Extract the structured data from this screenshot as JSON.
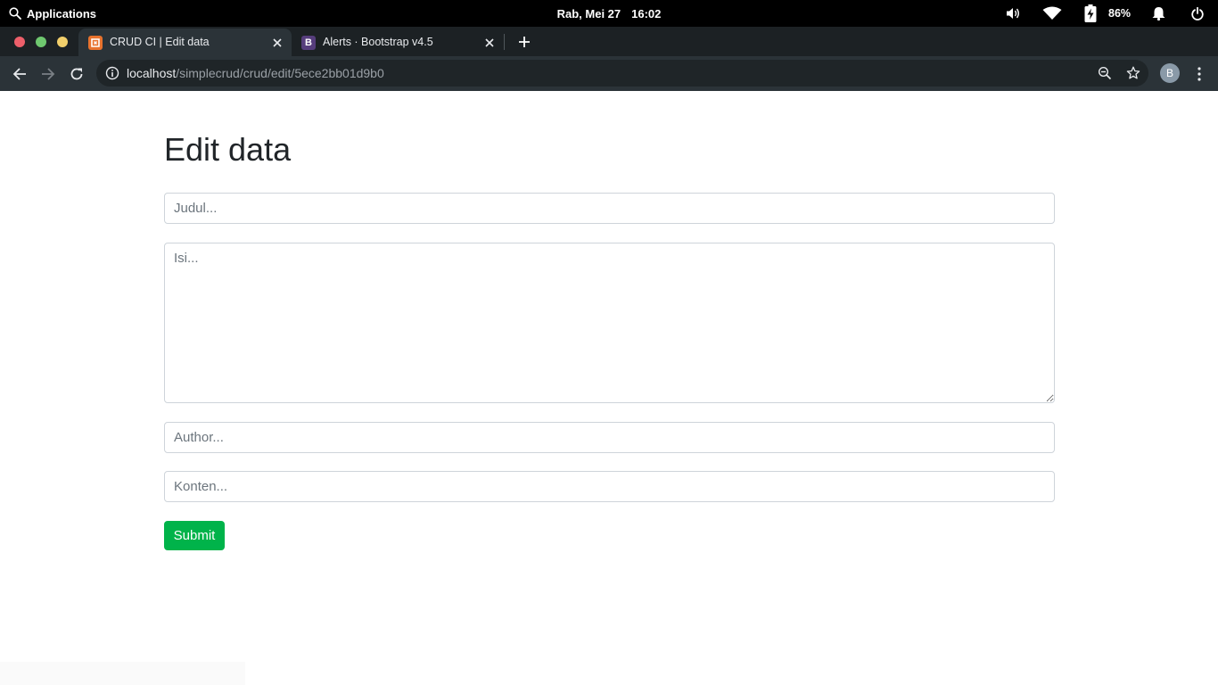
{
  "os_bar": {
    "applications_label": "Applications",
    "date": "Rab, Mei 27",
    "time": "16:02",
    "battery_percent": "86%",
    "icons": [
      "search-icon",
      "volume-icon",
      "wifi-icon",
      "battery-charging-icon",
      "bell-icon",
      "power-icon"
    ]
  },
  "browser": {
    "window_controls": [
      "close",
      "minimize",
      "maximize"
    ],
    "tabs": [
      {
        "title": "CRUD CI | Edit data",
        "favicon": "codeigniter-icon",
        "active": true
      },
      {
        "title": "Alerts · Bootstrap v4.5",
        "favicon": "bootstrap-icon",
        "favicon_letter": "B",
        "active": false
      }
    ],
    "address_bar": {
      "host": "localhost",
      "path": "/simplecrud/crud/edit/5ece2bb01d9b0"
    },
    "profile_initial": "B"
  },
  "page": {
    "heading": "Edit data",
    "form": {
      "judul_placeholder": "Judul...",
      "judul_value": "",
      "isi_placeholder": "Isi...",
      "isi_value": "",
      "author_placeholder": "Author...",
      "author_value": "",
      "konten_placeholder": "Konten...",
      "konten_value": "",
      "submit_label": "Submit"
    }
  },
  "colors": {
    "os_bar": "#000000",
    "tab_strip": "#1c2124",
    "toolbar": "#2b3338",
    "submit_button": "#00b34a",
    "heading_text": "#212529",
    "window_close": "#ed5f6a",
    "window_minimize": "#6fc86f",
    "window_maximize": "#f2cf6b"
  }
}
